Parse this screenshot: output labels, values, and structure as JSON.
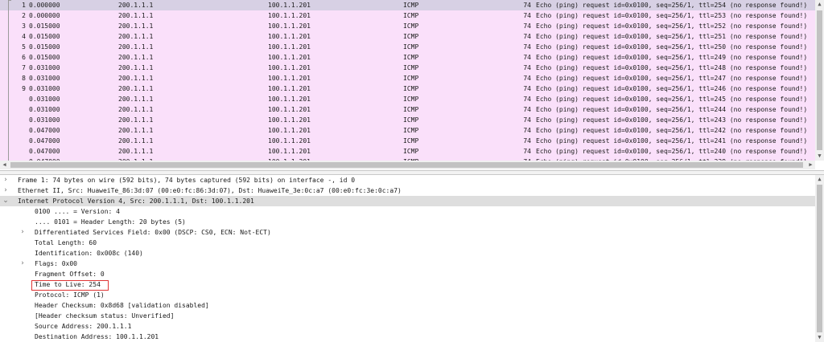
{
  "packet_list": {
    "rows": [
      {
        "no": "1",
        "time": "0.000000",
        "src": "200.1.1.1",
        "dst": "100.1.1.201",
        "proto": "ICMP",
        "len": "74",
        "info": "Echo (ping) request  id=0x0100, seq=256/1, ttl=254 (no response found!)",
        "selected": true
      },
      {
        "no": "2",
        "time": "0.000000",
        "src": "200.1.1.1",
        "dst": "100.1.1.201",
        "proto": "ICMP",
        "len": "74",
        "info": "Echo (ping) request  id=0x0100, seq=256/1, ttl=253 (no response found!)"
      },
      {
        "no": "3",
        "time": "0.015000",
        "src": "200.1.1.1",
        "dst": "100.1.1.201",
        "proto": "ICMP",
        "len": "74",
        "info": "Echo (ping) request  id=0x0100, seq=256/1, ttl=252 (no response found!)"
      },
      {
        "no": "4",
        "time": "0.015000",
        "src": "200.1.1.1",
        "dst": "100.1.1.201",
        "proto": "ICMP",
        "len": "74",
        "info": "Echo (ping) request  id=0x0100, seq=256/1, ttl=251 (no response found!)"
      },
      {
        "no": "5",
        "time": "0.015000",
        "src": "200.1.1.1",
        "dst": "100.1.1.201",
        "proto": "ICMP",
        "len": "74",
        "info": "Echo (ping) request  id=0x0100, seq=256/1, ttl=250 (no response found!)"
      },
      {
        "no": "6",
        "time": "0.015000",
        "src": "200.1.1.1",
        "dst": "100.1.1.201",
        "proto": "ICMP",
        "len": "74",
        "info": "Echo (ping) request  id=0x0100, seq=256/1, ttl=249 (no response found!)"
      },
      {
        "no": "7",
        "time": "0.031000",
        "src": "200.1.1.1",
        "dst": "100.1.1.201",
        "proto": "ICMP",
        "len": "74",
        "info": "Echo (ping) request  id=0x0100, seq=256/1, ttl=248 (no response found!)"
      },
      {
        "no": "8",
        "time": "0.031000",
        "src": "200.1.1.1",
        "dst": "100.1.1.201",
        "proto": "ICMP",
        "len": "74",
        "info": "Echo (ping) request  id=0x0100, seq=256/1, ttl=247 (no response found!)"
      },
      {
        "no": "9",
        "time": "0.031000",
        "src": "200.1.1.1",
        "dst": "100.1.1.201",
        "proto": "ICMP",
        "len": "74",
        "info": "Echo (ping) request  id=0x0100, seq=256/1, ttl=246 (no response found!)"
      },
      {
        "no": "",
        "time": "0.031000",
        "src": "200.1.1.1",
        "dst": "100.1.1.201",
        "proto": "ICMP",
        "len": "74",
        "info": "Echo (ping) request  id=0x0100, seq=256/1, ttl=245 (no response found!)"
      },
      {
        "no": "",
        "time": "0.031000",
        "src": "200.1.1.1",
        "dst": "100.1.1.201",
        "proto": "ICMP",
        "len": "74",
        "info": "Echo (ping) request  id=0x0100, seq=256/1, ttl=244 (no response found!)"
      },
      {
        "no": "",
        "time": "0.031000",
        "src": "200.1.1.1",
        "dst": "100.1.1.201",
        "proto": "ICMP",
        "len": "74",
        "info": "Echo (ping) request  id=0x0100, seq=256/1, ttl=243 (no response found!)"
      },
      {
        "no": "",
        "time": "0.047000",
        "src": "200.1.1.1",
        "dst": "100.1.1.201",
        "proto": "ICMP",
        "len": "74",
        "info": "Echo (ping) request  id=0x0100, seq=256/1, ttl=242 (no response found!)"
      },
      {
        "no": "",
        "time": "0.047000",
        "src": "200.1.1.1",
        "dst": "100.1.1.201",
        "proto": "ICMP",
        "len": "74",
        "info": "Echo (ping) request  id=0x0100, seq=256/1, ttl=241 (no response found!)"
      },
      {
        "no": "",
        "time": "0.047000",
        "src": "200.1.1.1",
        "dst": "100.1.1.201",
        "proto": "ICMP",
        "len": "74",
        "info": "Echo (ping) request  id=0x0100, seq=256/1, ttl=240 (no response found!)"
      },
      {
        "no": "",
        "time": "0.047000",
        "src": "200.1.1.1",
        "dst": "100.1.1.201",
        "proto": "ICMP",
        "len": "74",
        "info": "Echo (ping) request  id=0x0100, seq=256/1, ttl=239 (no response found!)"
      }
    ]
  },
  "detail_tree": [
    {
      "text": "Frame 1: 74 bytes on wire (592 bits), 74 bytes captured (592 bits) on interface -, id 0",
      "level": 0,
      "toggle": "collapsed"
    },
    {
      "text": "Ethernet II, Src: HuaweiTe_86:3d:07 (00:e0:fc:86:3d:07), Dst: HuaweiTe_3e:0c:a7 (00:e0:fc:3e:0c:a7)",
      "level": 0,
      "toggle": "collapsed"
    },
    {
      "text": "Internet Protocol Version 4, Src: 200.1.1.1, Dst: 100.1.1.201",
      "level": 0,
      "toggle": "expanded",
      "highlight": true
    },
    {
      "text": "0100 .... = Version: 4",
      "level": 2
    },
    {
      "text": ".... 0101 = Header Length: 20 bytes (5)",
      "level": 2
    },
    {
      "text": "Differentiated Services Field: 0x00 (DSCP: CS0, ECN: Not-ECT)",
      "level": 1,
      "toggle": "collapsed"
    },
    {
      "text": "Total Length: 60",
      "level": 1
    },
    {
      "text": "Identification: 0x008c (140)",
      "level": 1
    },
    {
      "text": "Flags: 0x00",
      "level": 1,
      "toggle": "collapsed"
    },
    {
      "text": "Fragment Offset: 0",
      "level": 1
    },
    {
      "text": "Time to Live: 254",
      "level": 1,
      "boxed": true
    },
    {
      "text": "Protocol: ICMP (1)",
      "level": 1
    },
    {
      "text": "Header Checksum: 0x8d68 [validation disabled]",
      "level": 1
    },
    {
      "text": "[Header checksum status: Unverified]",
      "level": 1
    },
    {
      "text": "Source Address: 200.1.1.1",
      "level": 1
    },
    {
      "text": "Destination Address: 100.1.1.201",
      "level": 1
    }
  ],
  "icons": {
    "collapsed": "chevron-right-icon",
    "expanded": "chevron-down-icon"
  },
  "colors": {
    "row_bg": "#fae0fa",
    "selected_row_bg": "#d7d0e4",
    "highlight_bg": "#dedede",
    "ttl_box": "#e03434"
  }
}
